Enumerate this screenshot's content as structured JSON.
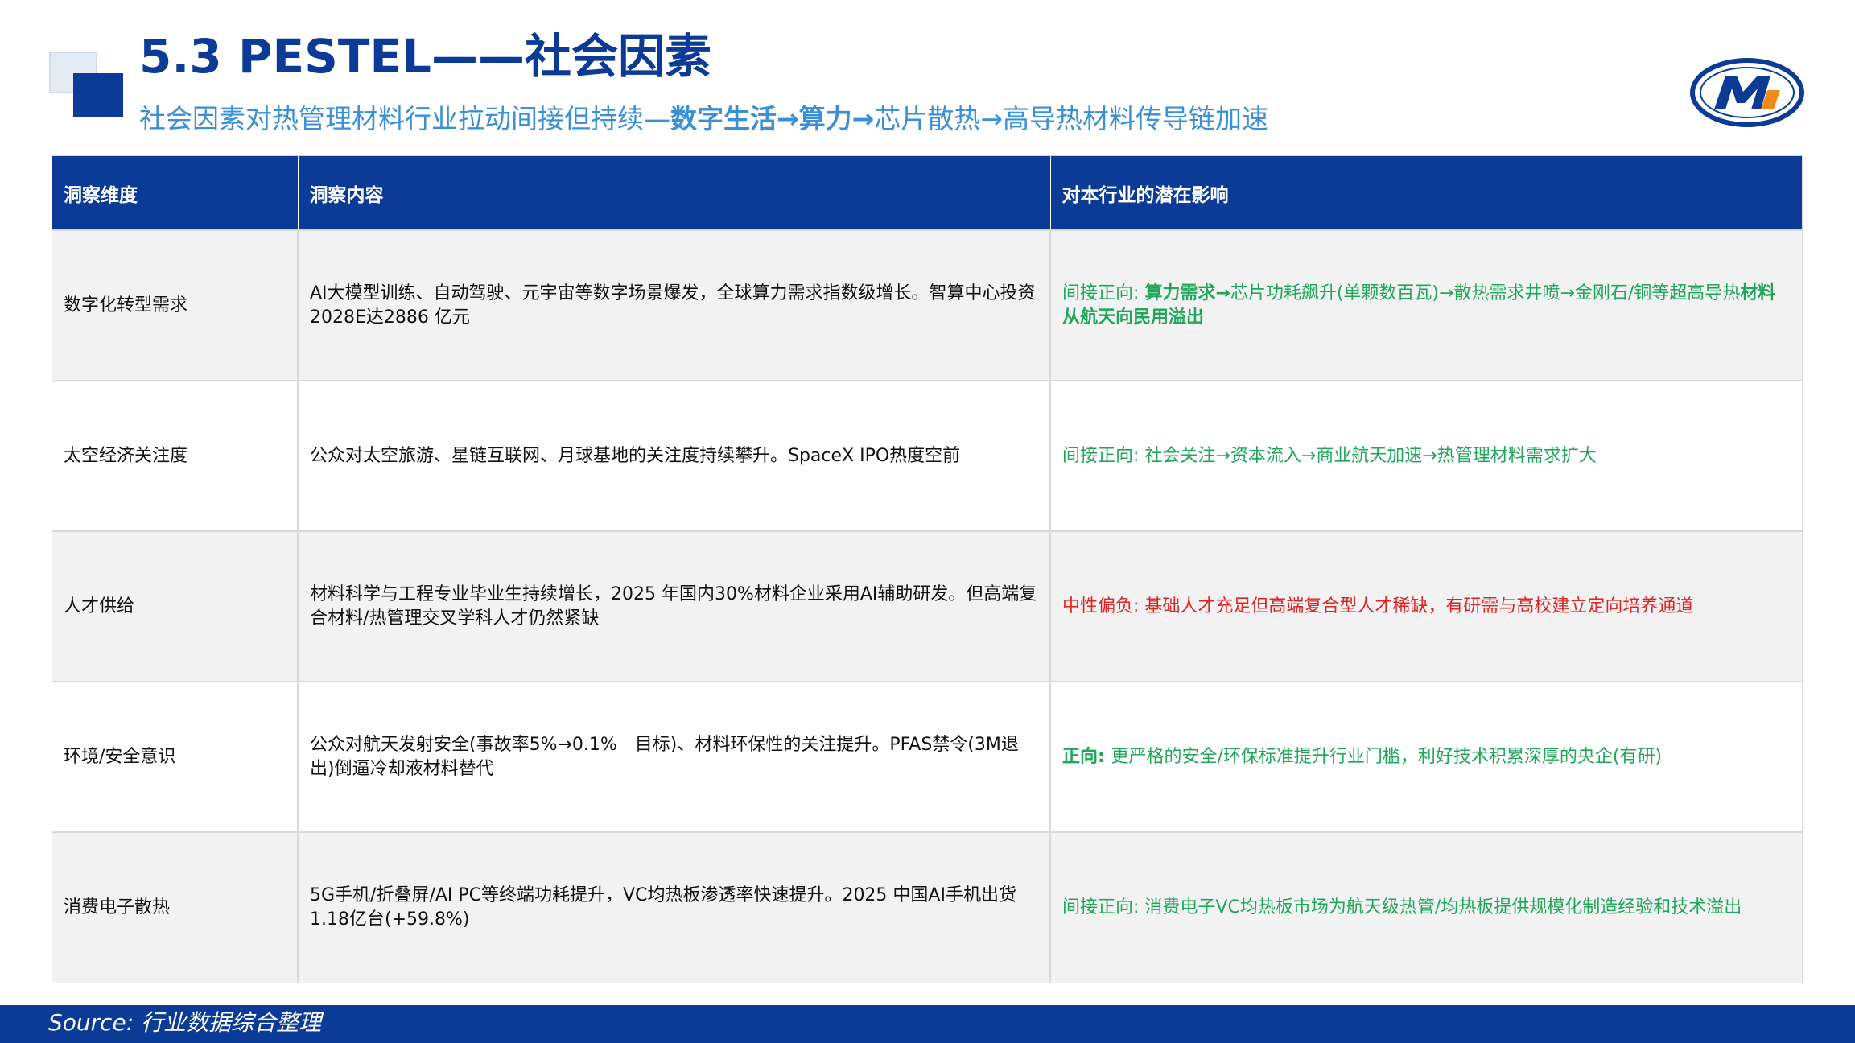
{
  "header": {
    "title": "5.3 PESTEL——社会因素",
    "subtitle_plain": "社会因素对热管理材料行业拉动间接但持续—",
    "subtitle_bold": "数字生活→算力→",
    "subtitle_tail": "芯片散热→高导热材料传导链加速"
  },
  "table": {
    "columns": [
      "洞察维度",
      "洞察内容",
      "对本行业的潜在影响"
    ],
    "rows": [
      {
        "dimension": "数字化转型需求",
        "content": "AI大模型训练、自动驾驶、元宇宙等数字场景爆发，全球算力需求指数级增长。智算中心投资2028E达2886 亿元",
        "impact_prefix": "间接正向: ",
        "impact_bold": "算力需求→",
        "impact_text": "芯片功耗飙升(单颗数百瓦)→散热需求井喷→金刚石/铜等超高导热",
        "impact_bold2": "材料从航天向民用溢出",
        "tone": "positive"
      },
      {
        "dimension": "太空经济关注度",
        "content": "公众对太空旅游、星链互联网、月球基地的关注度持续攀升。SpaceX IPO热度空前",
        "impact_prefix": "间接正向: ",
        "impact_bold": "",
        "impact_text": "社会关注→资本流入→商业航天加速→热管理材料需求扩大",
        "impact_bold2": "",
        "tone": "positive"
      },
      {
        "dimension": "人才供给",
        "content": "材料科学与工程专业毕业生持续增长，2025 年国内30%材料企业采用AI辅助研发。但高端复合材料/热管理交叉学科人才仍然紧缺",
        "impact_prefix": "中性偏负: ",
        "impact_bold": "",
        "impact_text": "基础人才充足但高端复合型人才稀缺，有研需与高校建立定向培养通道",
        "impact_bold2": "",
        "tone": "negative"
      },
      {
        "dimension": "环境/安全意识",
        "content": "公众对航天发射安全(事故率5%→0.1%　目标)、材料环保性的关注提升。PFAS禁令(3M退出)倒逼冷却液材料替代",
        "impact_prefix": "正向: ",
        "impact_bold": "",
        "impact_text": "更严格的安全/环保标准提升行业门槛，利好技术积累深厚的央企(有研)",
        "impact_bold2": "",
        "tone": "positive"
      },
      {
        "dimension": "消费电子散热",
        "content": "5G手机/折叠屏/AI PC等终端功耗提升，VC均热板渗透率快速提升。2025 中国AI手机出货1.18亿台(+59.8%)",
        "impact_prefix": "间接正向: ",
        "impact_bold": "",
        "impact_text": "消费电子VC均热板市场为航天级热管/均热板提供规模化制造经验和技术溢出",
        "impact_bold2": "",
        "tone": "positive"
      }
    ]
  },
  "footer": {
    "source": "Source: 行业数据综合整理"
  },
  "colors": {
    "brand_blue": "#0b3b96",
    "subtitle_blue": "#3a8fd6",
    "positive_green": "#1fa65a",
    "negative_red": "#e02424"
  },
  "icons": {
    "logo": "company-logo-m"
  }
}
